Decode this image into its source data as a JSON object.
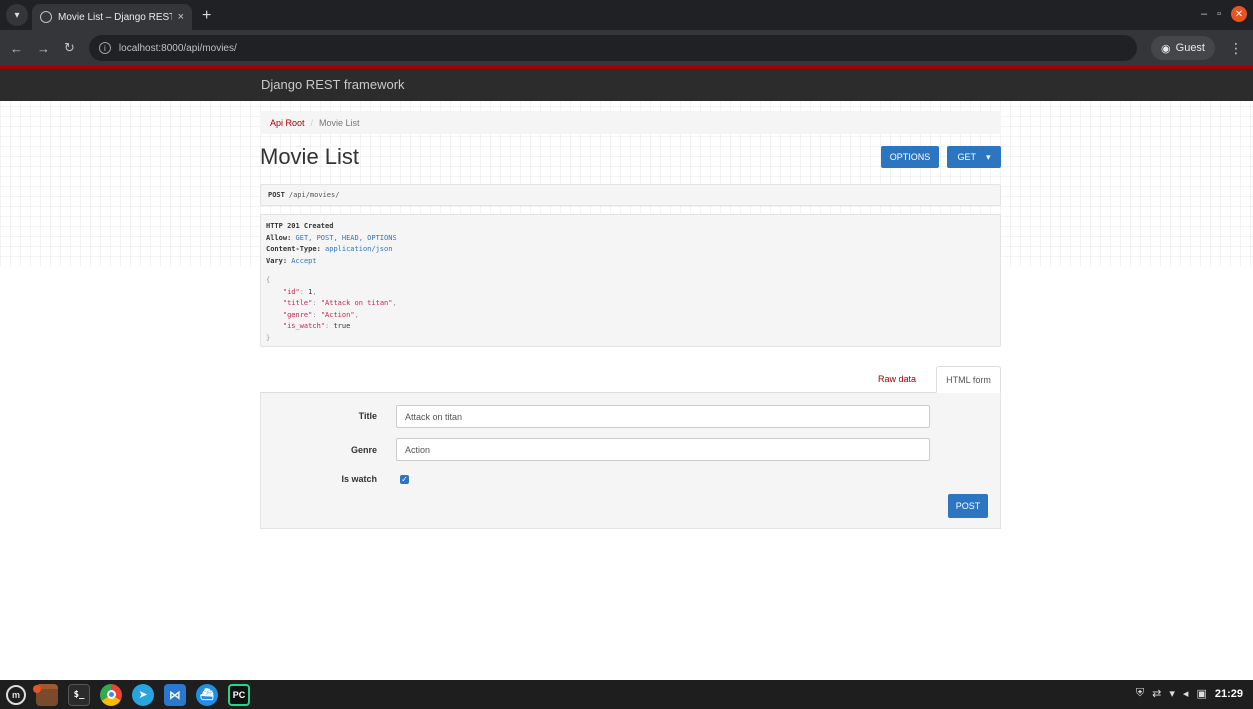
{
  "browser": {
    "tab_title": "Movie List – Django REST fra",
    "tab_close": "×",
    "new_tab": "+",
    "url": "localhost:8000/api/movies/",
    "profile_label": "Guest"
  },
  "navbar": {
    "brand": "Django REST framework"
  },
  "breadcrumb": {
    "root": "Api Root",
    "separator": "/",
    "current": "Movie List"
  },
  "page": {
    "title": "Movie List",
    "options_button": "OPTIONS",
    "get_button": "GET"
  },
  "request": {
    "method": "POST",
    "path": "/api/movies/"
  },
  "response": {
    "status": "HTTP 201 Created",
    "headers": [
      {
        "name": "Allow:",
        "value": "GET, POST, HEAD, OPTIONS"
      },
      {
        "name": "Content-Type:",
        "value": "application/json"
      },
      {
        "name": "Vary:",
        "value": "Accept"
      }
    ],
    "open_brace": "{",
    "close_brace": "}",
    "body": [
      {
        "key": "\"id\"",
        "value": "1",
        "comma": ","
      },
      {
        "key": "\"title\"",
        "value": "\"Attack on titan\"",
        "comma": ","
      },
      {
        "key": "\"genre\"",
        "value": "\"Action\"",
        "comma": ","
      },
      {
        "key": "\"is_watch\"",
        "value": "true",
        "comma": ""
      }
    ]
  },
  "form_tabs": {
    "raw": "Raw data",
    "html": "HTML form"
  },
  "form": {
    "title_label": "Title",
    "title_value": "Attack on titan",
    "genre_label": "Genre",
    "genre_value": "Action",
    "is_watch_label": "Is watch",
    "is_watch_checked": true,
    "post_button": "POST"
  },
  "taskbar": {
    "terminal_glyph": "$_",
    "pycharm_glyph": "PC",
    "time": "21:29"
  }
}
